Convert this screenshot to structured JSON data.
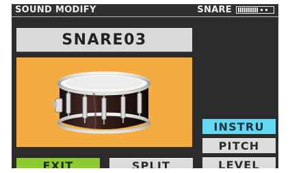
{
  "header": {
    "title": "SOUND MODIFY",
    "part": "SNARE",
    "meter_icon": "level-meter-icon"
  },
  "instrument": {
    "name": "SNARE03",
    "image_icon": "snare-drum-image"
  },
  "side_buttons": {
    "instru": "INSTRU",
    "pitch": "PITCH",
    "level": "LEVEL"
  },
  "bottom_buttons": {
    "exit": "EXIT",
    "split": "SPLIT"
  },
  "colors": {
    "background": "#2c2c2c",
    "image_panel": "#f4ab3f",
    "active_button": "#64d8f2",
    "exit_button": "#8dcc2e",
    "button_gray": "#dcdcdc"
  }
}
